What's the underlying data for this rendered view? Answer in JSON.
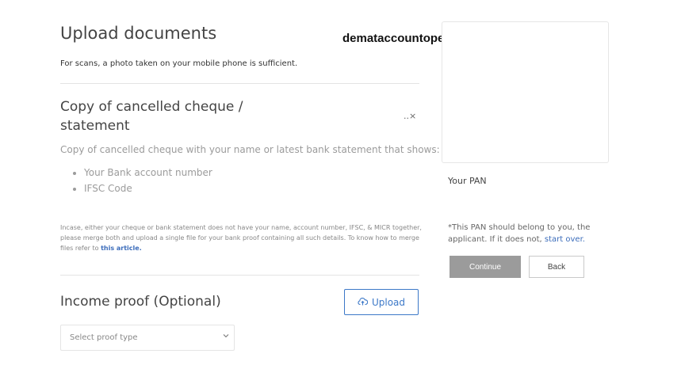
{
  "page": {
    "title": "Upload documents",
    "subtitle": "For scans, a photo taken on your mobile phone is sufficient.",
    "watermark": "demataccountopen.com"
  },
  "cheque": {
    "title": "Copy of cancelled cheque / statement",
    "close_label": "..×",
    "description": "Copy of cancelled cheque with your name or latest bank statement that shows:",
    "bullets": [
      "Your Bank account number",
      "IFSC Code"
    ],
    "note": "Incase, either your cheque or bank statement does not have your name, account number, IFSC, & MICR together, please merge both and upload a single file for your bank proof containing all such details. To know how to merge files refer to",
    "note_link": "this article."
  },
  "income": {
    "title": "Income proof (Optional)",
    "upload_label": "Upload",
    "select_placeholder": "Select proof type"
  },
  "pan": {
    "label": "Your PAN",
    "note": "*This PAN should belong to you, the applicant. If it does not,",
    "note_link": "start over."
  },
  "actions": {
    "continue_label": "Continue",
    "back_label": "Back"
  },
  "colors": {
    "accent": "#3c78c8",
    "continue_bg": "#9b9b9b"
  },
  "icons": {
    "upload": "cloud-upload-icon",
    "chevron": "chevron-down-icon",
    "close": "close-icon"
  }
}
